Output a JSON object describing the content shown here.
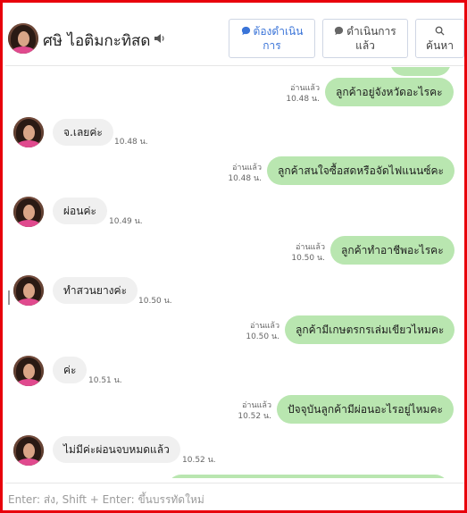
{
  "header": {
    "contact_name": "ศษิ ไอติมกะทิสด",
    "speaker_icon": "speaker-icon",
    "todo_button": {
      "line1": "ต้องดำเนิน",
      "line2": "การ",
      "icon": "chat-bubble-icon",
      "color": "#3a74d8"
    },
    "done_button": {
      "line1": "ดำเนินการ",
      "line2": "แล้ว",
      "icon": "chat-bubble-icon"
    },
    "search_button": {
      "label": "ค้นหา",
      "icon": "search-icon"
    }
  },
  "colors": {
    "frame": "#e8000b",
    "outgoing_bubble": "#b9e6b0",
    "incoming_bubble": "#f0f0f0"
  },
  "messages": [
    {
      "dir": "out",
      "text": "ลูกค้าอยู่จังหวัดอะไรคะ",
      "read": "อ่านแล้ว",
      "time": "10.48 น."
    },
    {
      "dir": "in",
      "text": "จ.เลยค่ะ",
      "time": "10.48 น."
    },
    {
      "dir": "out",
      "text": "ลูกค้าสนใจซื้อสดหรือจัดไฟแนนซ์คะ",
      "read": "อ่านแล้ว",
      "time": "10.48 น."
    },
    {
      "dir": "in",
      "text": "ผ่อนค่ะ",
      "time": "10.49 น."
    },
    {
      "dir": "out",
      "text": "ลูกค้าทำอาชีพอะไรคะ",
      "read": "อ่านแล้ว",
      "time": "10.50 น."
    },
    {
      "dir": "in",
      "text": "ทำสวนยางค่ะ",
      "time": "10.50 น."
    },
    {
      "dir": "out",
      "text": "ลูกค้ามีเกษตรกรเล่มเขียวไหมคะ",
      "read": "อ่านแล้ว",
      "time": "10.50 น."
    },
    {
      "dir": "in",
      "text": "ค่ะ",
      "time": "10.51 น."
    },
    {
      "dir": "out",
      "text": "ปัจจุบันลูกค้ามีผ่อนอะไรอยู่ไหมคะ",
      "read": "อ่านแล้ว",
      "time": "10.52 น."
    },
    {
      "dir": "in",
      "text": "ไม่มีค่ะผ่อนจบหมดแล้ว",
      "time": "10.52 น."
    }
  ],
  "composer": {
    "placeholder": "Enter: ส่ง, Shift + Enter: ขึ้นบรรทัดใหม่"
  }
}
